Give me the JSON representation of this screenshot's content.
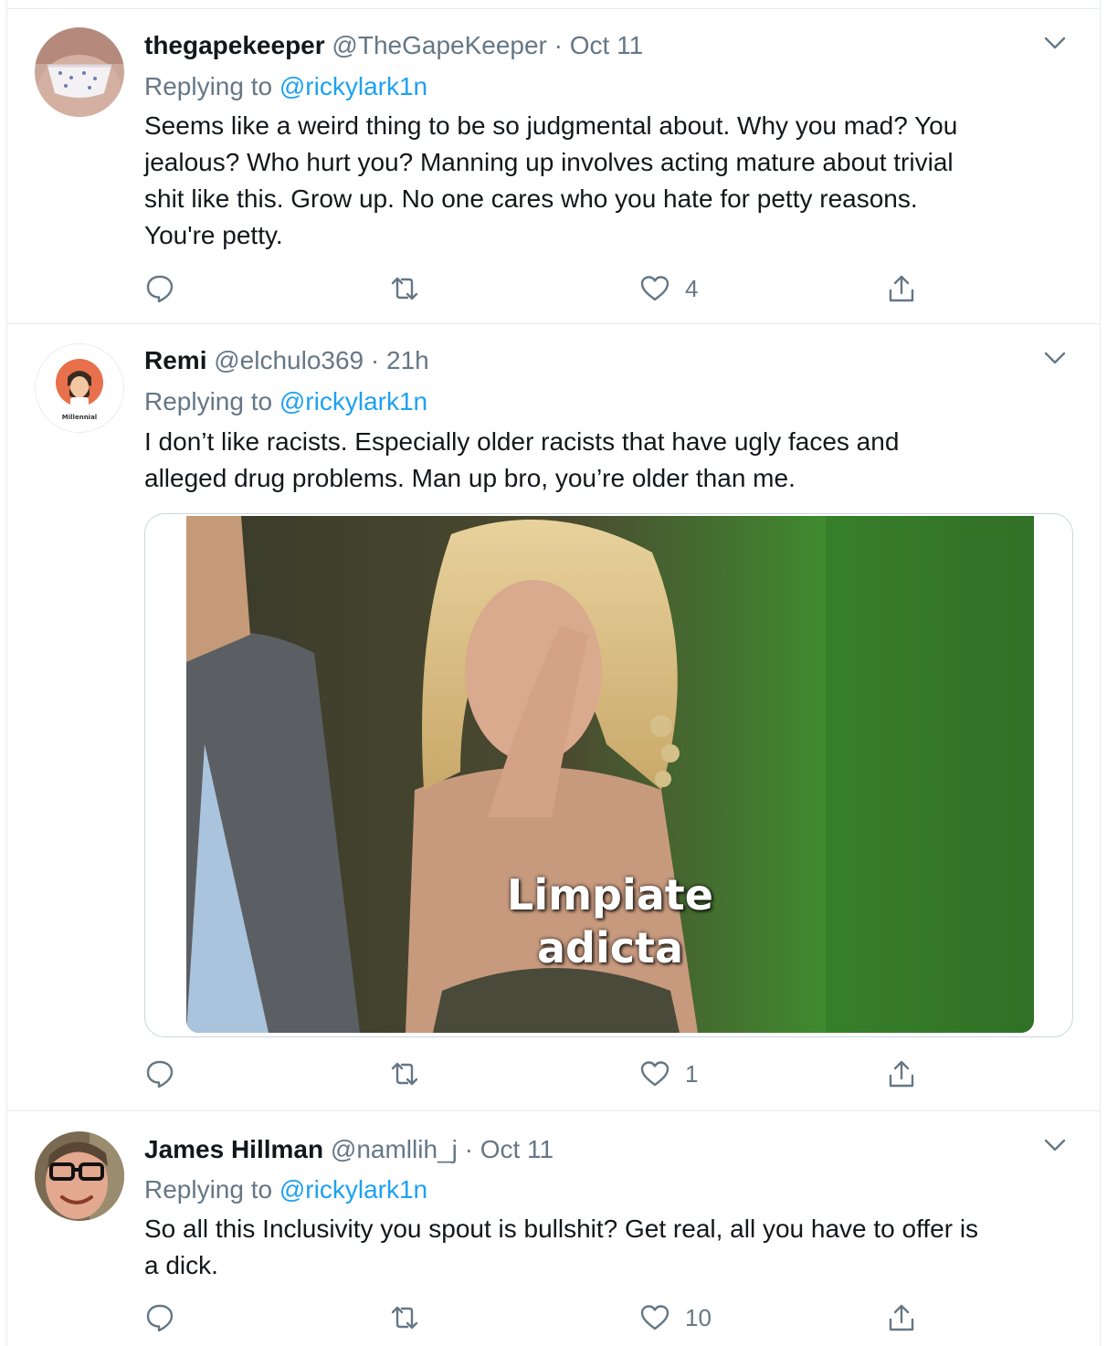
{
  "colors": {
    "text": "#14171a",
    "secondary": "#657786",
    "link": "#1da1f2",
    "border": "#e6ecf0"
  },
  "tweets": [
    {
      "name": "thegapekeeper",
      "handle": "@TheGapeKeeper",
      "separator": "·",
      "time": "Oct 11",
      "replying_prefix": "Replying to ",
      "replying_to": "@rickylark1n",
      "text_lines": [
        "Seems like a weird thing to be so judgmental about. Why you mad? You",
        "jealous? Who hurt you? Manning up involves acting mature about trivial",
        "shit like this. Grow up. No one cares who you hate for petty reasons.",
        "You're petty."
      ],
      "reply_count": "",
      "retweet_count": "",
      "like_count": "4"
    },
    {
      "name": "Remi",
      "handle": "@elchulo369",
      "separator": "·",
      "time": "21h",
      "avatar_badge": "Millennial",
      "replying_prefix": "Replying to ",
      "replying_to": "@rickylark1n",
      "text_lines": [
        "I don’t like racists. Especially older racists that have ugly faces and",
        "alleged drug problems. Man up bro, you’re older than me."
      ],
      "media_caption_lines": [
        "Limpiate",
        "adicta"
      ],
      "reply_count": "",
      "retweet_count": "",
      "like_count": "1"
    },
    {
      "name": "James Hillman",
      "handle": "@namllih_j",
      "separator": "·",
      "time": "Oct 11",
      "replying_prefix": "Replying to ",
      "replying_to": "@rickylark1n",
      "text_lines": [
        "So all this Inclusivity you spout is bullshit? Get real, all you have to offer is",
        "a dick."
      ],
      "reply_count": "",
      "retweet_count": "",
      "like_count": "10"
    }
  ]
}
